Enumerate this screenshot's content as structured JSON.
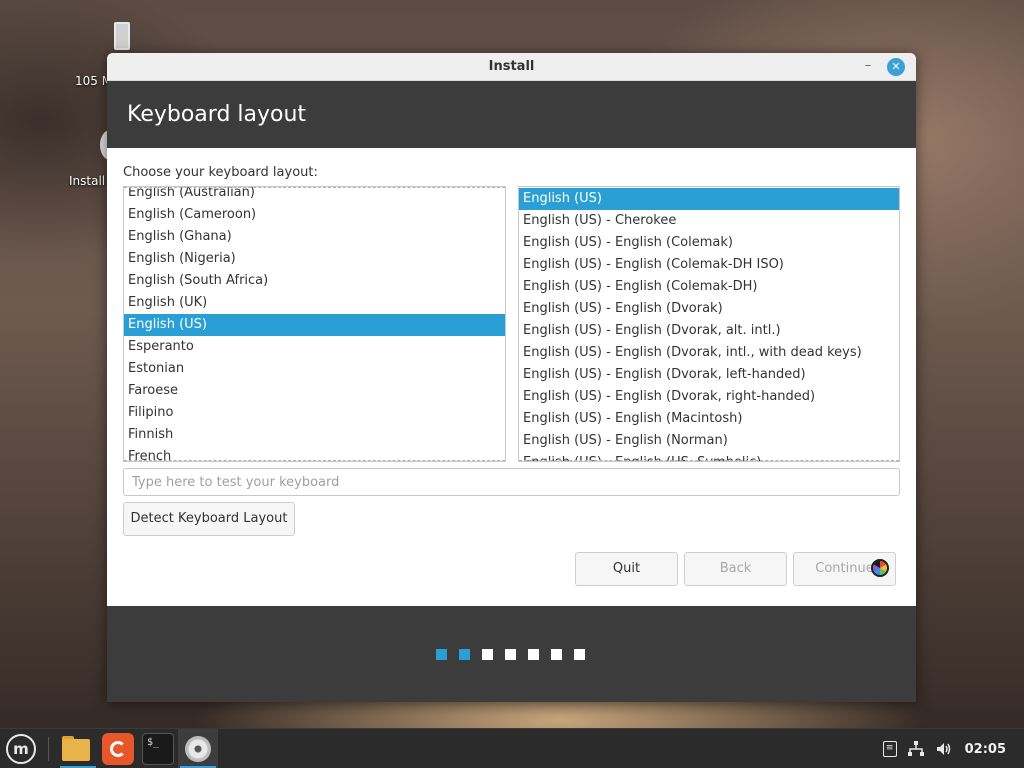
{
  "desktop": {
    "icons": [
      {
        "label": "105 M",
        "icon": "usb-drive-icon"
      },
      {
        "label": "Install",
        "icon": "disc-icon"
      }
    ]
  },
  "window": {
    "title": "Install",
    "minimize_glyph": "–",
    "close_glyph": "✕"
  },
  "header": {
    "title": "Keyboard layout"
  },
  "content": {
    "choose_label": "Choose your keyboard layout:",
    "layouts": [
      "English (Australian)",
      "English (Cameroon)",
      "English (Ghana)",
      "English (Nigeria)",
      "English (South Africa)",
      "English (UK)",
      "English (US)",
      "Esperanto",
      "Estonian",
      "Faroese",
      "Filipino",
      "Finnish",
      "French"
    ],
    "selected_layout": "English (US)",
    "variants": [
      "English (US)",
      "English (US) - Cherokee",
      "English (US) - English (Colemak)",
      "English (US) - English (Colemak-DH ISO)",
      "English (US) - English (Colemak-DH)",
      "English (US) - English (Dvorak)",
      "English (US) - English (Dvorak, alt. intl.)",
      "English (US) - English (Dvorak, intl., with dead keys)",
      "English (US) - English (Dvorak, left-handed)",
      "English (US) - English (Dvorak, right-handed)",
      "English (US) - English (Macintosh)",
      "English (US) - English (Norman)",
      "English (US) - English (US, Symbolic)"
    ],
    "selected_variant": "English (US)",
    "test_input": {
      "value": "",
      "placeholder": "Type here to test your keyboard"
    },
    "detect_button": "Detect Keyboard Layout"
  },
  "actions": {
    "quit": "Quit",
    "back": "Back",
    "continue": "Continue"
  },
  "progress": {
    "total_steps": 7,
    "completed_steps": 2
  },
  "taskbar": {
    "apps": [
      "mint-menu-icon",
      "files-icon",
      "firefox-icon",
      "terminal-icon",
      "disc-icon"
    ],
    "terminal_glyph": "$_",
    "menu_glyph": "m",
    "tray": {
      "icons": [
        "clipboard-icon",
        "network-icon",
        "volume-icon"
      ],
      "clock": "02:05"
    }
  },
  "colors": {
    "accent": "#2a9fd6",
    "header_bg": "#3c3c3c",
    "taskbar_bg": "#2b2b2b"
  }
}
